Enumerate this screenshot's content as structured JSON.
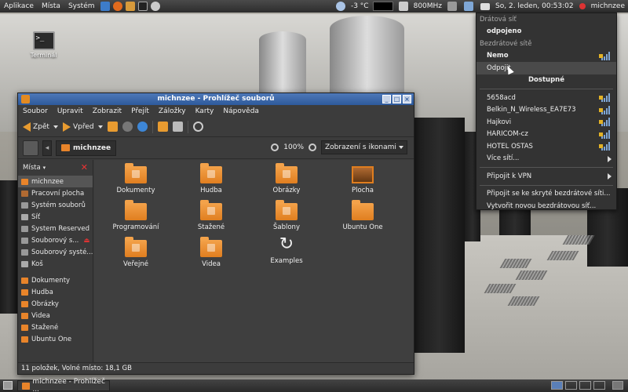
{
  "top_panel": {
    "menus": [
      "Aplikace",
      "Místa",
      "Systém"
    ],
    "weather": "-3 °C",
    "cpu_freq": "800MHz",
    "datetime": "So, 2. leden, 00:53:02",
    "user": "michnzee"
  },
  "desktop": {
    "icons": [
      {
        "label": "Terminál",
        "icon": "terminal-icon"
      }
    ]
  },
  "window": {
    "title": "michnzee - Prohlížeč souborů",
    "menu": [
      "Soubor",
      "Upravit",
      "Zobrazit",
      "Přejít",
      "Záložky",
      "Karty",
      "Nápověda"
    ],
    "toolbar": {
      "back": "Zpět",
      "forward": "Vpřed"
    },
    "location": {
      "current": "michnzee"
    },
    "zoom": "100%",
    "view_mode": "Zobrazení s ikonami",
    "sidebar": {
      "title": "Místa",
      "places": [
        "michnzee",
        "Pracovní plocha",
        "Systém souborů",
        "Síť",
        "System Reserved",
        "Souborový s...",
        "Souborový systé...",
        "Koš"
      ],
      "bookmarks": [
        "Dokumenty",
        "Hudba",
        "Obrázky",
        "Videa",
        "Stažené",
        "Ubuntu One"
      ]
    },
    "files": [
      "Dokumenty",
      "Hudba",
      "Obrázky",
      "Plocha",
      "Programování",
      "Stažené",
      "Šablony",
      "Ubuntu One",
      "Veřejné",
      "Videa",
      "Examples"
    ],
    "status": "11 položek, Volné místo: 18,1 GB"
  },
  "network_menu": {
    "wired_header": "Drátová síť",
    "wired_status": "odpojeno",
    "wireless_header": "Bezdrátové sítě",
    "connected": "Nemo",
    "disconnect": "Odpojit",
    "available_header": "Dostupné",
    "networks": [
      "5658acd",
      "Belkin_N_Wireless_EA7E73",
      "Hajkovi",
      "HARICOM-cz",
      "HOTEL OSTAS"
    ],
    "more": "Více sítí...",
    "vpn": "Připojit k VPN",
    "hidden": "Připojit se ke skryté bezdrátové síti...",
    "create": "Vytvořit novou bezdrátovou síť..."
  },
  "taskbar": {
    "task_label": "michnzee - Prohlížeč ..."
  },
  "colors": {
    "accent": "#2e5a9c",
    "folder": "#e8842a",
    "panel": "#2d2d2d"
  }
}
